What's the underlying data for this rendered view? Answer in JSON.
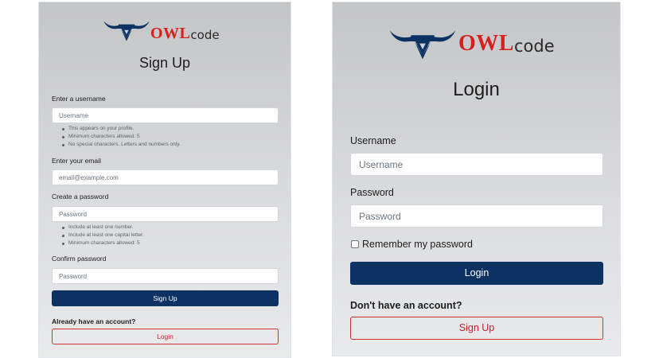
{
  "signup": {
    "logo": {
      "owl": "OWL",
      "code": "code"
    },
    "title": "Sign Up",
    "username": {
      "label": "Enter a username",
      "placeholder": "Username",
      "hints": [
        "This appears on your profile.",
        "Minimum characters allowed: 5",
        "No special characters. Letters and numbers only."
      ]
    },
    "email": {
      "label": "Enter your email",
      "placeholder": "email@example.com"
    },
    "password": {
      "label": "Create a password",
      "placeholder": "Password",
      "hints": [
        "Include at least one number.",
        "Include at least one capital letter.",
        "Minimum characters allowed: 5"
      ]
    },
    "confirm": {
      "label": "Confirm password",
      "placeholder": "Password"
    },
    "submit_label": "Sign Up",
    "have_account": "Already have an account?",
    "login_label": "Login"
  },
  "login": {
    "logo": {
      "owl": "OWL",
      "code": "code"
    },
    "title": "Login",
    "username": {
      "label": "Username",
      "placeholder": "Username"
    },
    "password": {
      "label": "Password",
      "placeholder": "Password"
    },
    "remember_label": "Remember my password",
    "submit_label": "Login",
    "no_account": "Don't have an account?",
    "signup_label": "Sign Up"
  },
  "colors": {
    "brand_navy": "#0b3263",
    "brand_red": "#d61f1f",
    "panel_top": "#c4c5c7",
    "panel_bottom": "#e9eaeb"
  }
}
